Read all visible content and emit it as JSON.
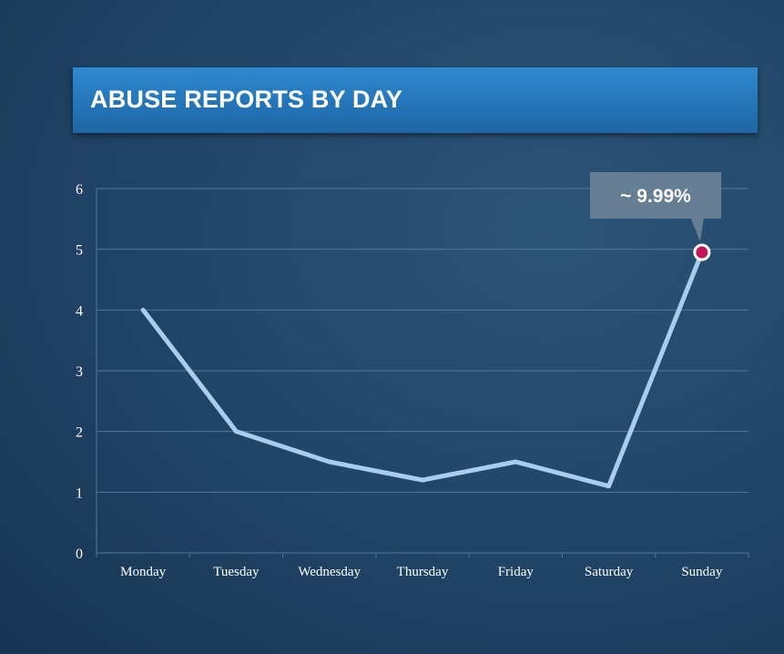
{
  "chart_data": {
    "type": "line",
    "title": "ABUSE REPORTS BY DAY",
    "categories": [
      "Monday",
      "Tuesday",
      "Wednesday",
      "Thursday",
      "Friday",
      "Saturday",
      "Sunday"
    ],
    "series": [
      {
        "values": [
          4,
          2,
          1.5,
          1.2,
          1.5,
          1.1,
          4.95
        ]
      }
    ],
    "ylim": [
      0,
      6
    ],
    "yticks": [
      "0",
      "1",
      "2",
      "3",
      "4",
      "5",
      "6"
    ],
    "grid": true,
    "annotation": {
      "text": "~ 9.99%",
      "category": "Sunday"
    },
    "colors": {
      "line": "#a9cdec",
      "marker": "#c2185b",
      "grid": "#4f7a9c",
      "callout": "#6a8296",
      "title_bar": "#2b80c4"
    }
  }
}
